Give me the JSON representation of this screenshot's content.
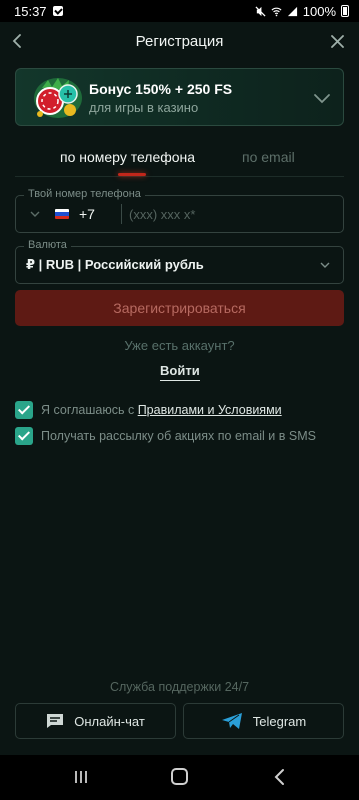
{
  "status_bar": {
    "time": "15:37",
    "battery": "100%"
  },
  "header": {
    "title": "Регистрация"
  },
  "bonus": {
    "title": "Бонус 150% + 250 FS",
    "subtitle": "для игры в казино"
  },
  "tabs": [
    {
      "label": "по номеру телефона",
      "active": true
    },
    {
      "label": "по email",
      "active": false
    }
  ],
  "phone": {
    "label": "Твой номер телефона",
    "country_code": "+7",
    "placeholder": "(xxx) xxx x*"
  },
  "currency": {
    "label": "Валюта",
    "value": "₽ | RUB | Российский рубль"
  },
  "register_button": "Зарегистрироваться",
  "have_account": "Уже есть аккаунт?",
  "login_link": "Войти",
  "agreements": {
    "terms_prefix": "Я соглашаюсь с ",
    "terms_link": "Правилами и Условиями",
    "terms_checked": true,
    "newsletter": "Получать рассылку об акциях по email и в SMS",
    "newsletter_checked": true
  },
  "support": {
    "label": "Служба поддержки 24/7",
    "chat_button": "Онлайн-чат",
    "telegram_button": "Telegram"
  },
  "colors": {
    "accent": "#c2271b",
    "checkbox": "#2aa58a",
    "background": "#0b1513",
    "telegram": "#2a9fd8"
  }
}
